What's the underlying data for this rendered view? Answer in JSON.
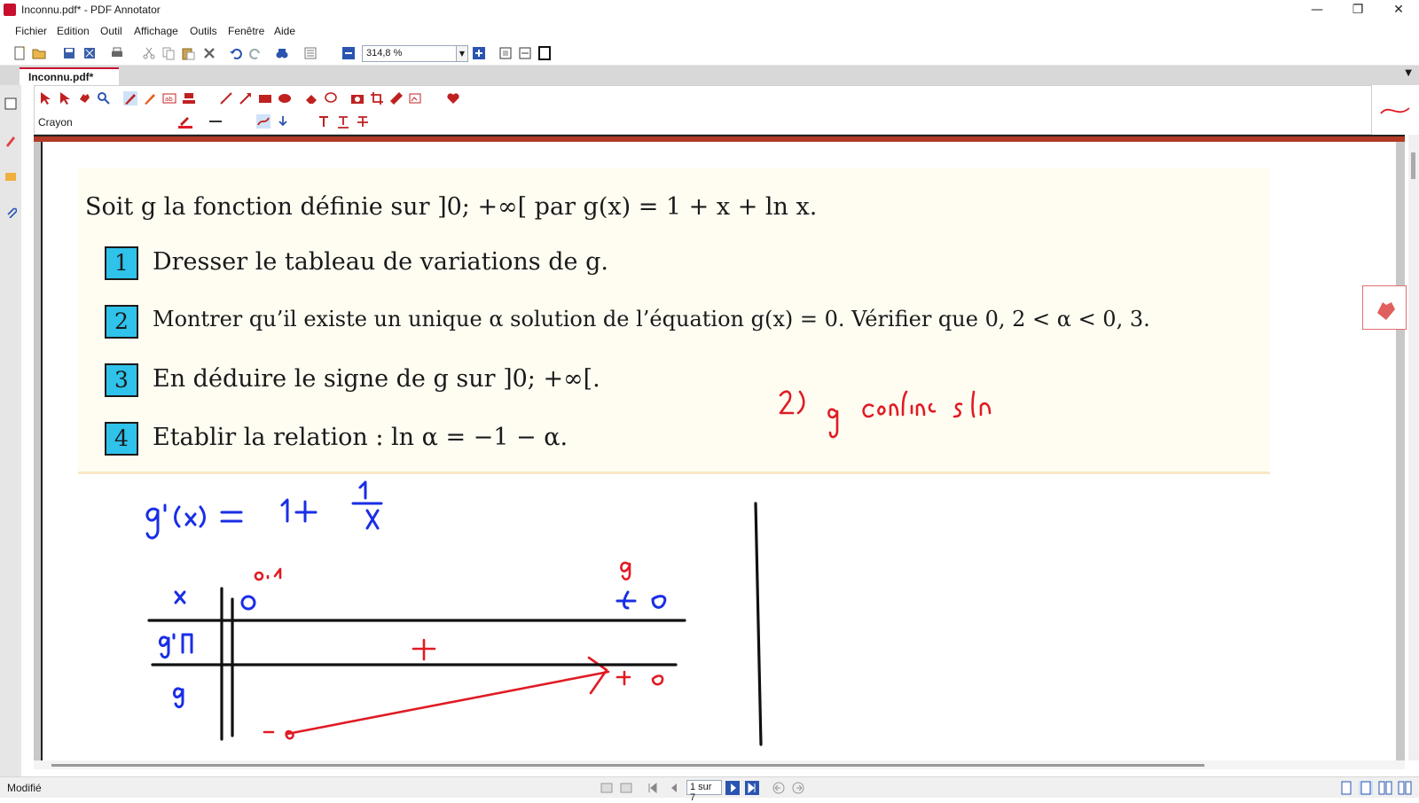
{
  "window": {
    "title": "Inconnu.pdf* - PDF Annotator",
    "controls": {
      "minimize": "—",
      "restore": "❐",
      "close": "✕"
    }
  },
  "menu": [
    "Fichier",
    "Edition",
    "Outil",
    "Affichage",
    "Outils",
    "Fenêtre",
    "Aide"
  ],
  "toolbar": {
    "zoom_value": "314,8 %"
  },
  "tabs": [
    {
      "label": "Inconnu.pdf*"
    }
  ],
  "annotation_toolbar": {
    "tool_name": "Crayon"
  },
  "document": {
    "intro": "Soit g la fonction définie sur ]0; +∞[ par g(x) = 1 + x + ln x.",
    "questions": [
      {
        "num": "1",
        "text": "Dresser le tableau de variations de g."
      },
      {
        "num": "2",
        "text": "Montrer qu’il existe un unique α solution de l’équation g(x) = 0. Vérifier que 0, 2 < α < 0, 3."
      },
      {
        "num": "3",
        "text": "En déduire le signe de g sur ]0; +∞[."
      },
      {
        "num": "4",
        "text": "Etablir la relation : ln α = −1 − α."
      }
    ],
    "ink_colors": {
      "blue": "#1a2ee6",
      "red": "#e01b24",
      "black": "#111111"
    }
  },
  "status": {
    "text": "Modifié",
    "page_indicator": "1 sur 7"
  }
}
